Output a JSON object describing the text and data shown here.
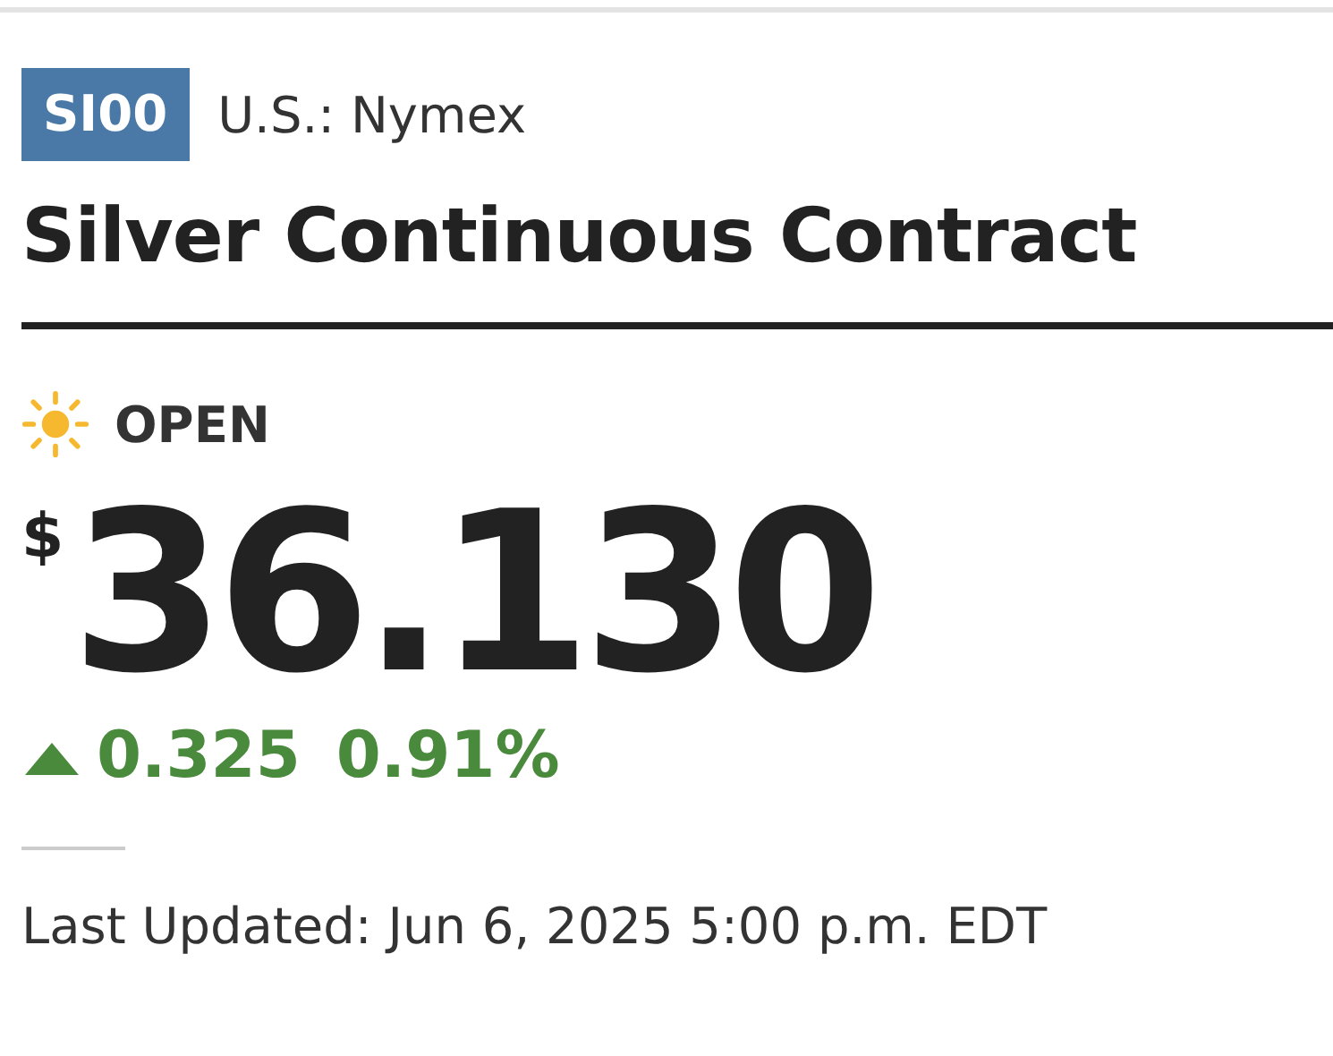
{
  "ticker": "SI00",
  "exchange": "U.S.: Nymex",
  "title": "Silver Continuous Contract",
  "market_status": {
    "open": true,
    "label": "OPEN"
  },
  "price": {
    "currency": "$",
    "value": "36.130"
  },
  "change": {
    "up": true,
    "amount": "0.325",
    "percent": "0.91%"
  },
  "last_updated": "Last Updated: Jun 6, 2025 5:00 p.m. EDT"
}
